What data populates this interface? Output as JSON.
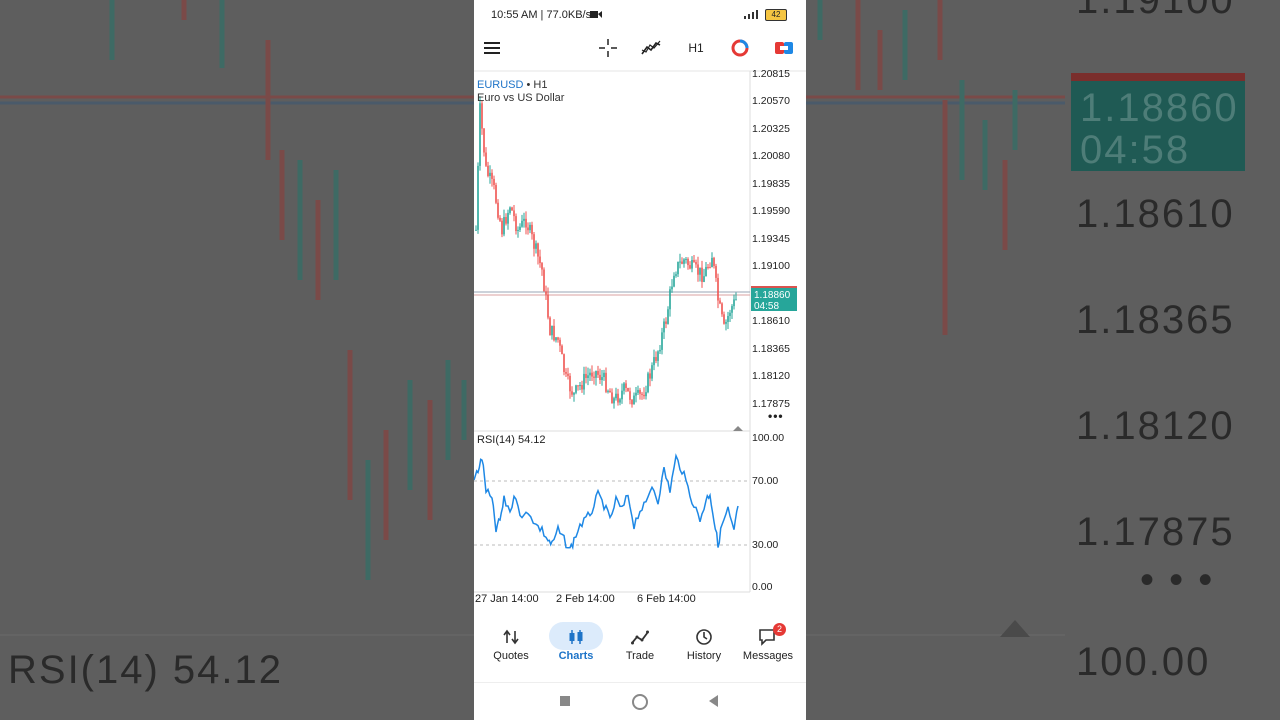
{
  "status_bar": {
    "time": "10:55 AM | 77.0KB/s",
    "battery": "42"
  },
  "toolbar": {
    "timeframe": "H1"
  },
  "chart": {
    "symbol": "EURUSD",
    "timeframe_suffix": " • H1",
    "description": "Euro vs US Dollar",
    "price_ticks": [
      "1.20815",
      "1.20570",
      "1.20325",
      "1.20080",
      "1.19835",
      "1.19590",
      "1.19345",
      "1.19100",
      "1.18610",
      "1.18365",
      "1.18120",
      "1.17875"
    ],
    "current_price": "1.18860",
    "countdown": "04:58",
    "more_label": "•••"
  },
  "rsi": {
    "label": "RSI(14) 54.12",
    "ticks": [
      "100.00",
      "70.00",
      "30.00",
      "0.00"
    ]
  },
  "dates": [
    "27 Jan 14:00",
    "2 Feb 14:00",
    "6 Feb 14:00"
  ],
  "nav": {
    "quotes": "Quotes",
    "charts": "Charts",
    "trade": "Trade",
    "history": "History",
    "messages": "Messages",
    "messages_badge": "2"
  },
  "background": {
    "prices": [
      "1.19100",
      "1.18860",
      "04:58",
      "1.18610",
      "1.18365",
      "1.18120",
      "1.17875",
      "100.00"
    ],
    "rsi_label": "RSI(14) 54.12",
    "more": "• • •"
  },
  "colors": {
    "up": "#26a69a",
    "down": "#ef5350",
    "accent": "#1e74c8",
    "rsi_line": "#1e88e5",
    "price_tag": "#26a69a"
  }
}
